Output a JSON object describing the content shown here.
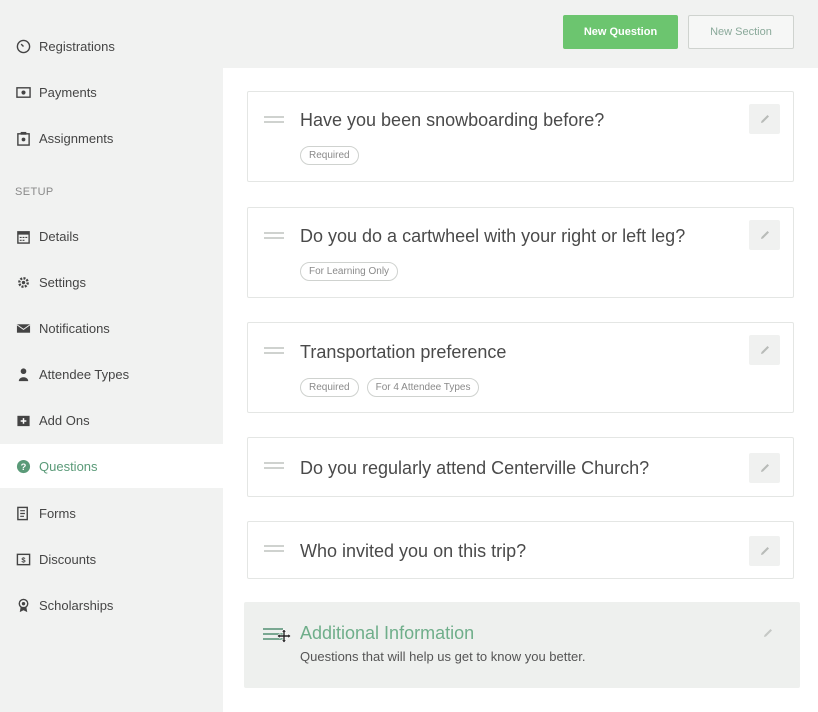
{
  "sidebar": {
    "items_top": [
      {
        "label": "Registrations",
        "icon": "gauge-icon"
      },
      {
        "label": "Payments",
        "icon": "money-icon"
      },
      {
        "label": "Assignments",
        "icon": "assignment-icon"
      }
    ],
    "section_label": "SETUP",
    "items_setup": [
      {
        "label": "Details",
        "icon": "calendar-icon"
      },
      {
        "label": "Settings",
        "icon": "gear-icon"
      },
      {
        "label": "Notifications",
        "icon": "envelope-icon"
      },
      {
        "label": "Attendee Types",
        "icon": "user-icon"
      },
      {
        "label": "Add Ons",
        "icon": "add-box-icon"
      },
      {
        "label": "Questions",
        "icon": "question-circle-icon",
        "active": true
      },
      {
        "label": "Forms",
        "icon": "forms-icon"
      },
      {
        "label": "Discounts",
        "icon": "discount-icon"
      },
      {
        "label": "Scholarships",
        "icon": "award-icon"
      }
    ]
  },
  "toolbar": {
    "new_question_label": "New Question",
    "new_section_label": "New Section"
  },
  "questions": [
    {
      "title": "Have you been snowboarding before?",
      "badges": [
        "Required"
      ]
    },
    {
      "title": "Do you do a cartwheel with your right or left leg?",
      "badges": [
        "For Learning Only"
      ]
    },
    {
      "title": "Transportation preference",
      "badges": [
        "Required",
        "For 4 Attendee Types"
      ]
    },
    {
      "title": "Do you regularly attend Centerville Church?",
      "badges": []
    },
    {
      "title": "Who invited you on this trip?",
      "badges": []
    }
  ],
  "section": {
    "title": "Additional Information",
    "description": "Questions that will help us get to know you better."
  },
  "colors": {
    "accent_green": "#6cc56f",
    "active_text": "#5a9a78",
    "sidebar_bg": "#f1f2f1"
  }
}
